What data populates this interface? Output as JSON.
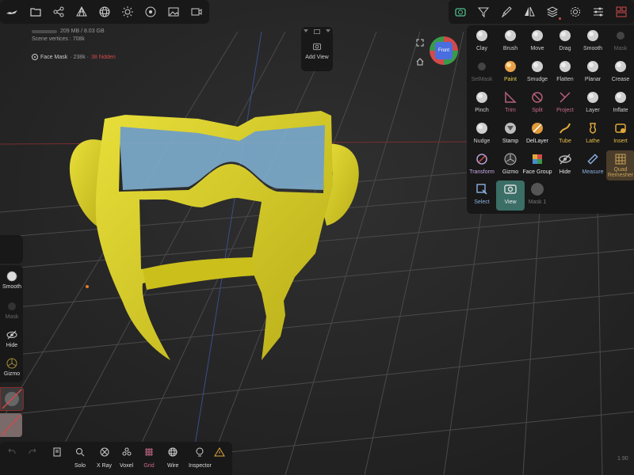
{
  "colors": {
    "mask_yellow": "#d7ce29",
    "mask_blue": "#7fb2d3",
    "accent_green": "#3a6e66",
    "record_red": "#d24a4a"
  },
  "top_toolbar": {
    "icons": [
      "logo-icon",
      "folder-icon",
      "share-icon",
      "mesh-icon",
      "sphere-icon",
      "sun-icon",
      "material-icon",
      "image-icon",
      "video-icon"
    ]
  },
  "stats": {
    "memory": "209 MB / 8.03 GB",
    "scene_vertices": "Scene vertices : 708k",
    "object": "Face Mask",
    "object_vertices": "· 238k ·",
    "object_hidden": "38 hidden"
  },
  "view_widget": {
    "add_view_label": "Add View",
    "cube_label": "Front"
  },
  "right_toolbar": {
    "icons": [
      "camera-icon",
      "filter-icon",
      "paint-icon",
      "symmetry-icon",
      "layers-icon",
      "settings-icon",
      "sliders-icon",
      "scene-icon"
    ]
  },
  "tools_panel": {
    "rows": [
      [
        {
          "label": "Clay",
          "icon": "sphere"
        },
        {
          "label": "Brush",
          "icon": "sphere"
        },
        {
          "label": "Move",
          "icon": "sphere"
        },
        {
          "label": "Drag",
          "icon": "sphere"
        },
        {
          "label": "Smooth",
          "icon": "sphere"
        },
        {
          "label": "Mask",
          "icon": "dot"
        }
      ],
      [
        {
          "label": "SelMask",
          "icon": "dot"
        },
        {
          "label": "Paint",
          "icon": "paint"
        },
        {
          "label": "Smudge",
          "icon": "sphere"
        },
        {
          "label": "Flatten",
          "icon": "sphere"
        },
        {
          "label": "Planar",
          "icon": "sphere"
        },
        {
          "label": "Crease",
          "icon": "sphere"
        }
      ],
      [
        {
          "label": "Pinch",
          "icon": "sphere"
        },
        {
          "label": "Trim",
          "icon": "trim"
        },
        {
          "label": "Split",
          "icon": "split"
        },
        {
          "label": "Project",
          "icon": "project"
        },
        {
          "label": "Layer",
          "icon": "sphere"
        },
        {
          "label": "Inflate",
          "icon": "sphere"
        }
      ],
      [
        {
          "label": "Nudge",
          "icon": "sphere"
        },
        {
          "label": "Stamp",
          "icon": "stamp"
        },
        {
          "label": "DelLayer",
          "icon": "dellayer"
        },
        {
          "label": "Tube",
          "icon": "tube"
        },
        {
          "label": "Lathe",
          "icon": "lathe"
        },
        {
          "label": "Insert",
          "icon": "insert"
        }
      ],
      [
        {
          "label": "Transform",
          "icon": "transform"
        },
        {
          "label": "Gizmo",
          "icon": "gizmo"
        },
        {
          "label": "Face Group",
          "icon": "facegroup"
        },
        {
          "label": "Hide",
          "icon": "hide"
        },
        {
          "label": "Measure",
          "icon": "measure"
        },
        {
          "label": "Quad Remesher",
          "icon": "quad"
        }
      ],
      [
        {
          "label": "Select",
          "icon": "select"
        },
        {
          "label": "View",
          "icon": "view"
        },
        {
          "label": "Mask 1",
          "icon": "mask1"
        }
      ]
    ],
    "selected": "View"
  },
  "left_panel": {
    "tools": [
      {
        "label": "Smooth",
        "icon": "smooth-icon"
      },
      {
        "label": "Mask",
        "icon": "mask-icon"
      },
      {
        "label": "Hide",
        "icon": "hide-icon"
      },
      {
        "label": "Gizmo",
        "icon": "gizmo-icon"
      }
    ]
  },
  "bottom_toolbar": {
    "items": [
      {
        "label": "",
        "icon": "undo-icon"
      },
      {
        "label": "",
        "icon": "redo-icon"
      },
      {
        "label": "",
        "icon": "document-icon"
      },
      {
        "label": "Solo",
        "icon": "search-icon"
      },
      {
        "label": "X Ray",
        "icon": "xray-icon"
      },
      {
        "label": "Voxel",
        "icon": "voxel-icon"
      },
      {
        "label": "Grid",
        "icon": "grid-icon"
      },
      {
        "label": "Wire",
        "icon": "wire-icon"
      },
      {
        "label": "Inspector",
        "icon": "inspector-icon"
      },
      {
        "label": "",
        "icon": "warning-icon"
      }
    ]
  },
  "version": "1.90"
}
